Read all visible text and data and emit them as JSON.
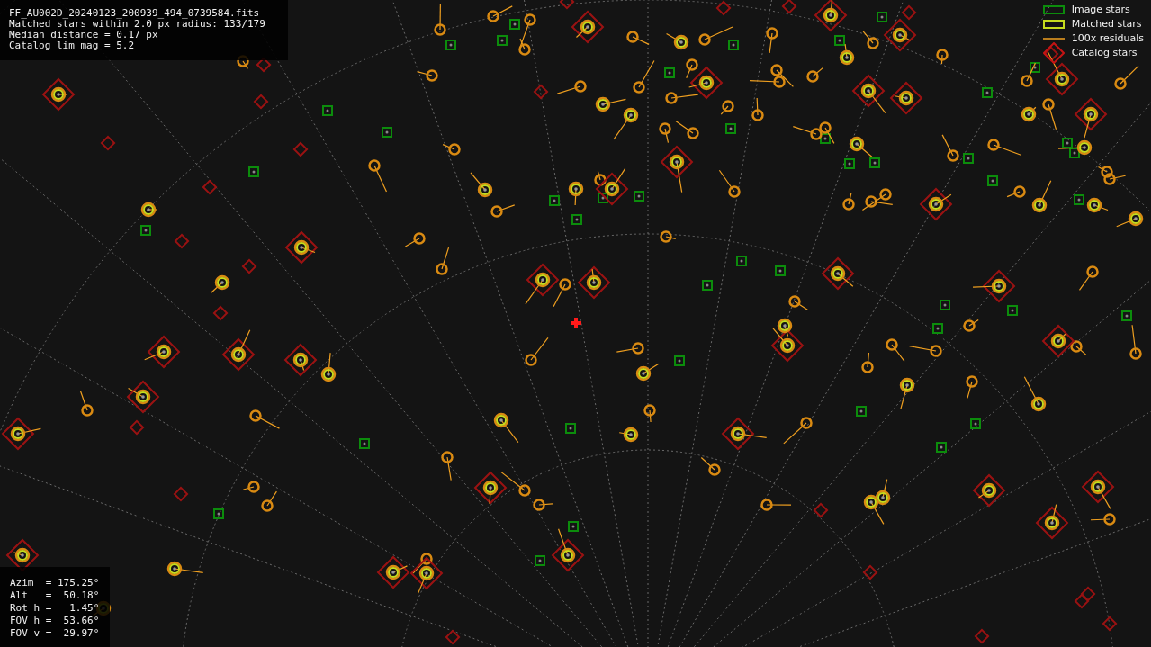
{
  "header": {
    "lines": [
      "FF_AU002D_20240123_200939_494_0739584.fits",
      "Matched stars within 2.0 px radius: 133/179",
      "Median distance = 0.17 px",
      "Catalog lim mag = 5.2"
    ]
  },
  "legend": [
    {
      "kind": "image",
      "label": "Image stars"
    },
    {
      "kind": "matched",
      "label": "Matched stars"
    },
    {
      "kind": "residual",
      "label": "100x residuals"
    },
    {
      "kind": "catalog",
      "label": "Catalog stars"
    }
  ],
  "pointing": {
    "lines": [
      "Azim  = 175.25°",
      "Alt   =  50.18°",
      "Rot h =   1.45°",
      "FOV h =  53.66°",
      "FOV v =  29.97°"
    ]
  }
}
